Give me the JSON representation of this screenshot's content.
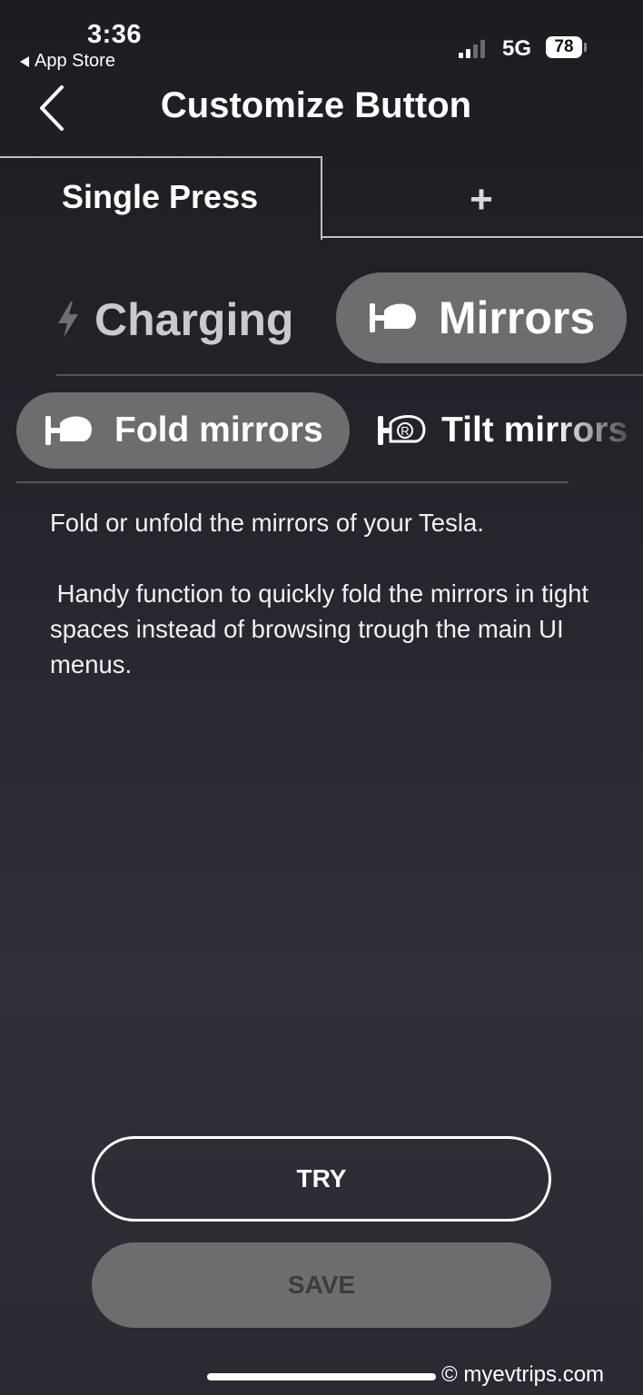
{
  "status_bar": {
    "time": "3:36",
    "back_app": "App Store",
    "network": "5G",
    "battery": "78"
  },
  "header": {
    "title": "Customize Button"
  },
  "tabs": {
    "single_press": "Single Press",
    "add": "+"
  },
  "categories": [
    {
      "label": "Charging",
      "icon": "lightning-icon",
      "selected": false
    },
    {
      "label": "Mirrors",
      "icon": "mirror-icon",
      "selected": true
    }
  ],
  "actions": [
    {
      "label": "Fold mirrors",
      "icon": "mirror-fold-icon",
      "selected": true
    },
    {
      "label": "Tilt mirrors",
      "icon": "mirror-tilt-icon",
      "selected": false
    }
  ],
  "description": {
    "line1": "Fold or unfold the mirrors of your Tesla.",
    "line2": " Handy function to quickly fold the mirrors in tight spaces instead of browsing trough the main UI menus."
  },
  "buttons": {
    "try": "TRY",
    "save": "SAVE"
  },
  "watermark": "© myevtrips.com",
  "colors": {
    "pill_bg": "#6d6d6f",
    "save_text": "#3c3c40"
  }
}
